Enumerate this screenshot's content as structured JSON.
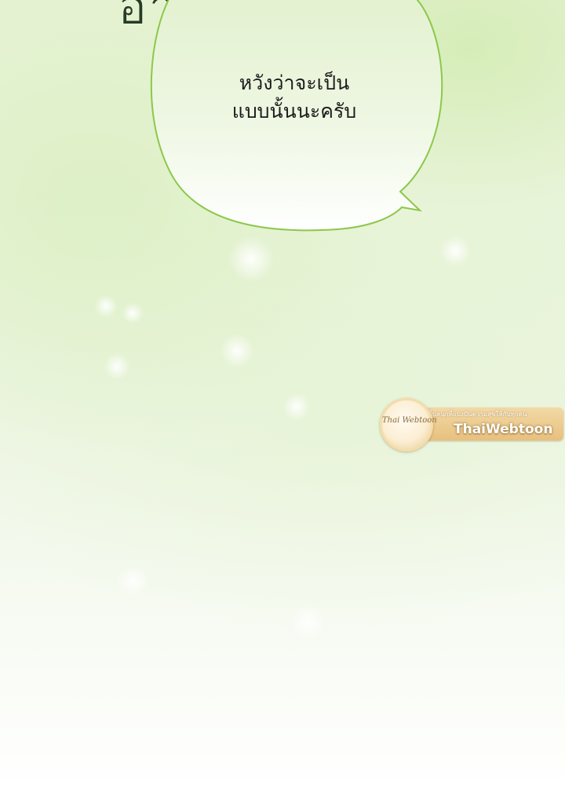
{
  "panel": {
    "heading_fragment": "อาอา"
  },
  "speech_bubble": {
    "line_1": "หวังว่าจะเป็น",
    "line_2": "แบบนั้นนะครับ"
  },
  "watermark": {
    "tagline": "เว็บสนุกที่แบ่งปันความสุขให้กับทุกคน",
    "name": "ThaiWebtoon",
    "logo_text": "Thai Webtoon"
  },
  "colors": {
    "background_tint": "#e6f2d4",
    "bubble_outline": "#8cc84b",
    "bubble_fill": "#eef7e2",
    "text": "#1b1b1b",
    "watermark_gold": "#e7c07e"
  }
}
